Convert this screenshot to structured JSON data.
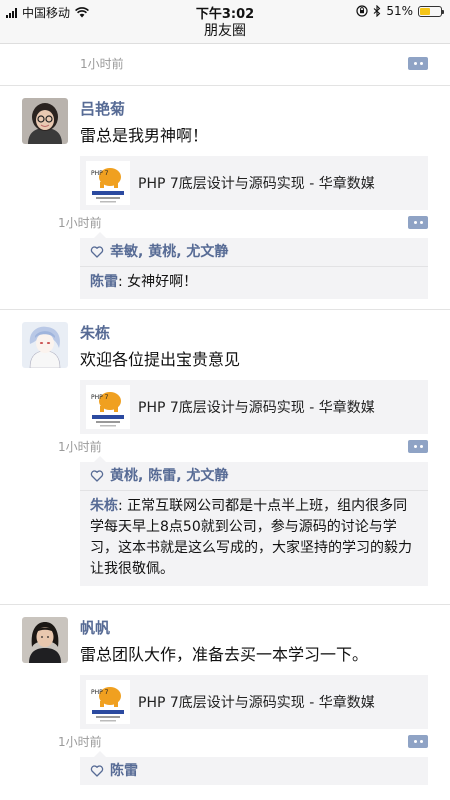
{
  "status_bar": {
    "carrier": "中国移动",
    "time": "下午3:02",
    "battery": "51%",
    "battery_level": 0.51
  },
  "nav": {
    "title": "朋友圈"
  },
  "top_partial": {
    "time": "1小时前"
  },
  "posts": [
    {
      "name": "吕艳菊",
      "text": "雷总是我男神啊！",
      "share_title": "PHP 7底层设计与源码实现 - 华章数媒",
      "time": "1小时前",
      "likes": [
        "幸敏",
        "黄桃",
        "尤文静"
      ],
      "comments": [
        {
          "author": "陈雷",
          "text": "女神好啊！"
        }
      ]
    },
    {
      "name": "朱栋",
      "text": "欢迎各位提出宝贵意见",
      "share_title": "PHP 7底层设计与源码实现 - 华章数媒",
      "time": "1小时前",
      "likes": [
        "黄桃",
        "陈雷",
        "尤文静"
      ],
      "comments": [
        {
          "author": "朱栋",
          "text": "正常互联网公司都是十点半上班，组内很多同学每天早上8点50就到公司，参与源码的讨论与学习，这本书就是这么写成的，大家坚持的学习的毅力让我很敬佩。"
        }
      ]
    },
    {
      "name": "帆帆",
      "text": "雷总团队大作，准备去买一本学习一下。",
      "share_title": "PHP 7底层设计与源码实现 - 华章数媒",
      "time": "1小时前",
      "likes": [
        "陈雷"
      ],
      "comments": []
    }
  ],
  "colors": {
    "link": "#576b95",
    "more_button": "#8fa3c5",
    "panel": "#f3f3f5"
  },
  "icons": [
    "signal-icon",
    "wifi-icon",
    "lock-rotation-icon",
    "bluetooth-icon",
    "battery-icon",
    "more-comment-icon",
    "heart-icon",
    "book-cover-icon"
  ]
}
